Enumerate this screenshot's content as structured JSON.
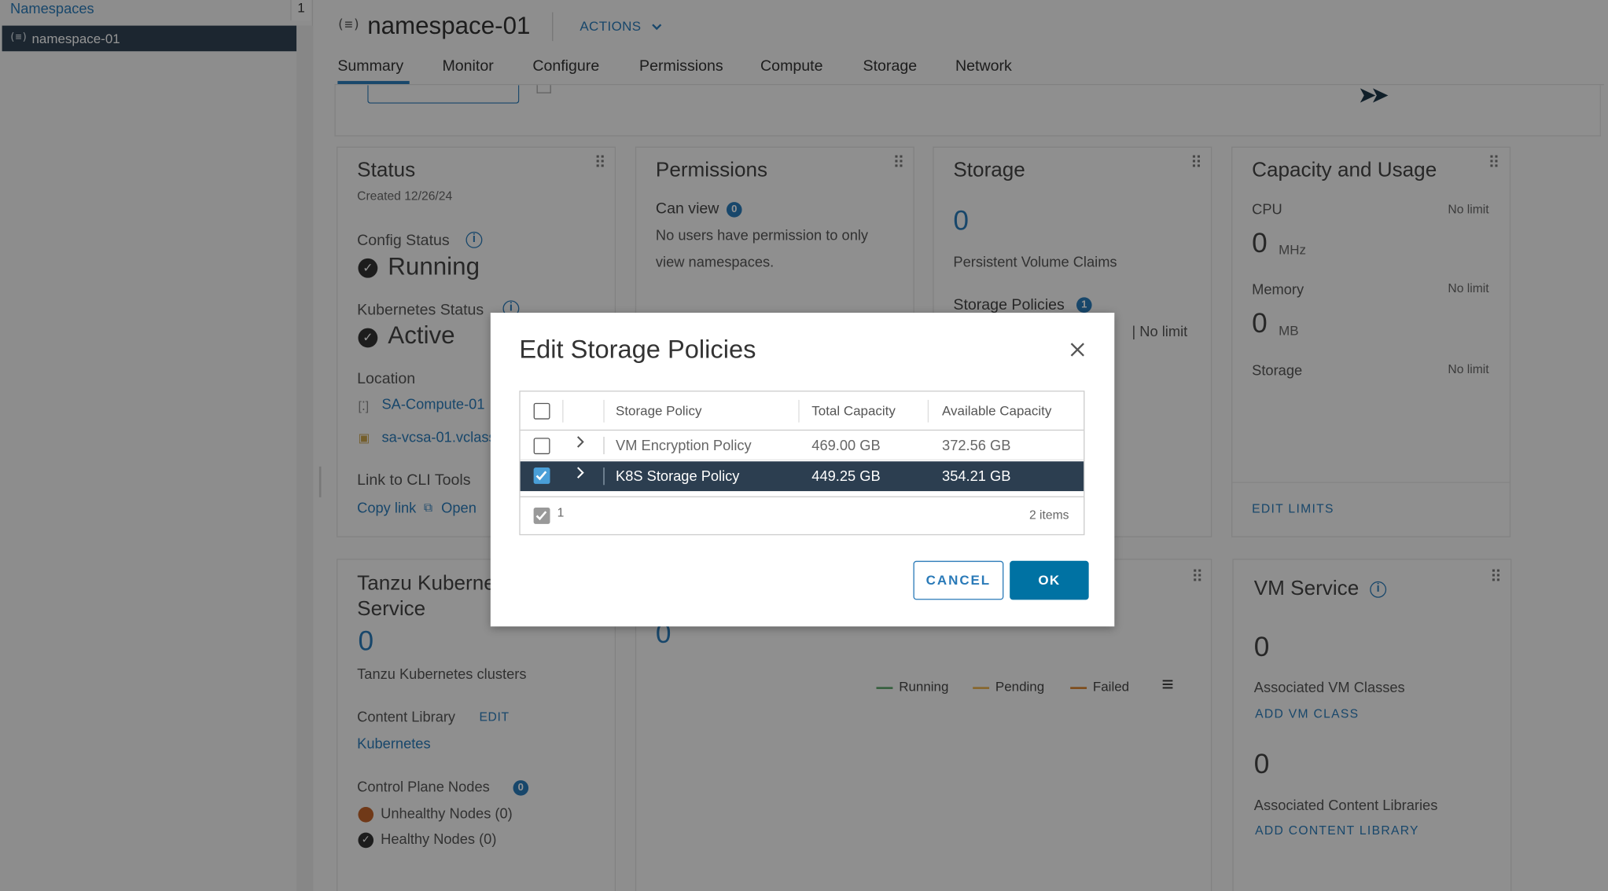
{
  "sidebar": {
    "title": "Namespaces",
    "count": "1",
    "selected_item": "namespace-01"
  },
  "header": {
    "title": "namespace-01",
    "actions_label": "ACTIONS"
  },
  "tabs": [
    "Summary",
    "Monitor",
    "Configure",
    "Permissions",
    "Compute",
    "Storage",
    "Network"
  ],
  "active_tab": "Summary",
  "status_card": {
    "title": "Status",
    "created": "Created 12/26/24",
    "config_status_label": "Config Status",
    "config_status_value": "Running",
    "k8s_status_label": "Kubernetes Status",
    "k8s_status_value": "Active",
    "location_label": "Location",
    "location_compute": "SA-Compute-01",
    "location_vcsa": "sa-vcsa-01.vclass",
    "cli_label": "Link to CLI Tools",
    "copy_link": "Copy link",
    "open": "Open"
  },
  "permissions_card": {
    "title": "Permissions",
    "can_view": "Can view",
    "can_view_badge": "0",
    "no_users_line1": "No users have permission to only",
    "no_users_line2": "view namespaces."
  },
  "storage_card": {
    "title": "Storage",
    "pvc_count": "0",
    "pvc_label": "Persistent Volume Claims",
    "policies_label": "Storage Policies",
    "policies_badge": "1",
    "no_limit": "No limit"
  },
  "capacity_card": {
    "title": "Capacity and Usage",
    "cpu_label": "CPU",
    "cpu_limit": "No limit",
    "cpu_value": "0",
    "cpu_unit": "MHz",
    "memory_label": "Memory",
    "memory_limit": "No limit",
    "memory_value": "0",
    "memory_unit": "MB",
    "storage_label": "Storage",
    "storage_limit": "No limit",
    "edit_limits": "EDIT LIMITS"
  },
  "tanzu_card": {
    "title_line1": "Tanzu Kubernetes",
    "title_line2": "Service",
    "clusters_count": "0",
    "clusters_label": "Tanzu Kubernetes clusters",
    "content_library_label": "Content Library",
    "edit": "EDIT",
    "kubernetes": "Kubernetes",
    "control_plane_label": "Control Plane Nodes",
    "control_plane_badge": "0",
    "unhealthy": "Unhealthy Nodes (0)",
    "healthy": "Healthy Nodes (0)"
  },
  "pods_card": {
    "count": "0",
    "legend_running": "Running",
    "legend_pending": "Pending",
    "legend_failed": "Failed",
    "colors": {
      "running": "#5aa469",
      "pending": "#e8b04a",
      "failed": "#d9822b"
    }
  },
  "vm_service_card": {
    "title": "VM Service",
    "vm_classes_count": "0",
    "vm_classes_label": "Associated VM Classes",
    "add_vm_class": "ADD VM CLASS",
    "content_libraries_count": "0",
    "content_libraries_label": "Associated Content Libraries",
    "add_content_library": "ADD CONTENT LIBRARY"
  },
  "modal": {
    "title": "Edit Storage Policies",
    "columns": [
      "Storage Policy",
      "Total Capacity",
      "Available Capacity"
    ],
    "rows": [
      {
        "policy": "VM Encryption Policy",
        "total": "469.00 GB",
        "available": "372.56 GB",
        "selected": false
      },
      {
        "policy": "K8S Storage Policy",
        "total": "449.25 GB",
        "available": "354.21 GB",
        "selected": true
      }
    ],
    "footer_selected": "1",
    "footer_items": "2 items",
    "cancel_label": "CANCEL",
    "ok_label": "OK"
  },
  "colors": {
    "accent": "#2a7ab8",
    "primary_button": "#0072a3",
    "selected_row": "#2c3e50",
    "sidebar_selected": "#314354"
  }
}
